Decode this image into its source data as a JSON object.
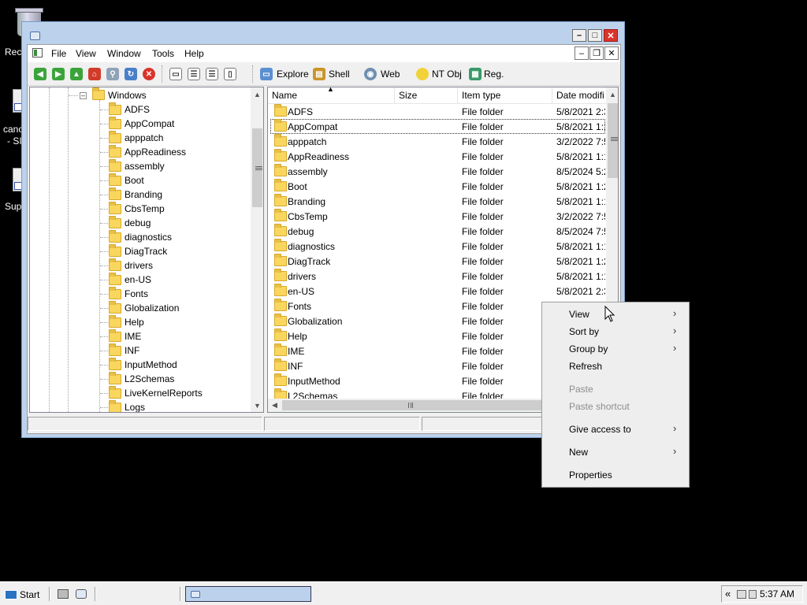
{
  "desktop": {
    "icons": [
      {
        "label": "Rec",
        "icon": "recycle-bin-icon"
      },
      {
        "label_line1": "canc",
        "label_line2": "- SI",
        "icon": "shortcut-icon"
      },
      {
        "label": "Sup",
        "icon": "shortcut-icon"
      }
    ]
  },
  "window": {
    "title": "",
    "menu": [
      "File",
      "View",
      "Window",
      "Tools",
      "Help"
    ],
    "toolbar": {
      "nav_icons": [
        "back-icon",
        "forward-icon",
        "up-icon",
        "home-icon",
        "search-icon",
        "refresh-icon",
        "stop-icon",
        "new-window-icon",
        "tile-horizontal-icon",
        "tile-vertical-icon",
        "cascade-icon"
      ],
      "buttons": [
        {
          "label": "Explore",
          "icon": "explore-icon"
        },
        {
          "label": "Shell",
          "icon": "shell-icon"
        },
        {
          "label": "Web",
          "icon": "web-icon"
        },
        {
          "label": "NT Obj",
          "icon": "nt-obj-icon"
        },
        {
          "label": "Reg.",
          "icon": "registry-icon"
        }
      ]
    },
    "tree": {
      "root": "Windows",
      "children": [
        "ADFS",
        "AppCompat",
        "apppatch",
        "AppReadiness",
        "assembly",
        "Boot",
        "Branding",
        "CbsTemp",
        "debug",
        "diagnostics",
        "DiagTrack",
        "drivers",
        "en-US",
        "Fonts",
        "Globalization",
        "Help",
        "IME",
        "INF",
        "InputMethod",
        "L2Schemas",
        "LiveKernelReports",
        "Logs"
      ]
    },
    "list": {
      "columns": [
        "Name",
        "Size",
        "Item type",
        "Date modifi"
      ],
      "sort_column": "Name",
      "focused_row": "AppCompat",
      "rows": [
        {
          "name": "ADFS",
          "size": "",
          "type": "File folder",
          "date": "5/8/2021 2:3"
        },
        {
          "name": "AppCompat",
          "size": "",
          "type": "File folder",
          "date": "5/8/2021 1:1"
        },
        {
          "name": "apppatch",
          "size": "",
          "type": "File folder",
          "date": "3/2/2022 7:5"
        },
        {
          "name": "AppReadiness",
          "size": "",
          "type": "File folder",
          "date": "5/8/2021 1:1"
        },
        {
          "name": "assembly",
          "size": "",
          "type": "File folder",
          "date": "8/5/2024 5:2"
        },
        {
          "name": "Boot",
          "size": "",
          "type": "File folder",
          "date": "5/8/2021 1:2"
        },
        {
          "name": "Branding",
          "size": "",
          "type": "File folder",
          "date": "5/8/2021 1:1"
        },
        {
          "name": "CbsTemp",
          "size": "",
          "type": "File folder",
          "date": "3/2/2022 7:5"
        },
        {
          "name": "debug",
          "size": "",
          "type": "File folder",
          "date": "8/5/2024 7:5"
        },
        {
          "name": "diagnostics",
          "size": "",
          "type": "File folder",
          "date": "5/8/2021 1:1"
        },
        {
          "name": "DiagTrack",
          "size": "",
          "type": "File folder",
          "date": "5/8/2021 1:2"
        },
        {
          "name": "drivers",
          "size": "",
          "type": "File folder",
          "date": "5/8/2021 1:1"
        },
        {
          "name": "en-US",
          "size": "",
          "type": "File folder",
          "date": "5/8/2021 2:3"
        },
        {
          "name": "Fonts",
          "size": "",
          "type": "File folder",
          "date": ""
        },
        {
          "name": "Globalization",
          "size": "",
          "type": "File folder",
          "date": ""
        },
        {
          "name": "Help",
          "size": "",
          "type": "File folder",
          "date": ""
        },
        {
          "name": "IME",
          "size": "",
          "type": "File folder",
          "date": ""
        },
        {
          "name": "INF",
          "size": "",
          "type": "File folder",
          "date": ""
        },
        {
          "name": "InputMethod",
          "size": "",
          "type": "File folder",
          "date": ""
        },
        {
          "name": "L2Schemas",
          "size": "",
          "type": "File folder",
          "date": ""
        }
      ]
    }
  },
  "context_menu": {
    "items": [
      {
        "label": "View",
        "submenu": true,
        "disabled": false
      },
      {
        "label": "Sort by",
        "submenu": true,
        "disabled": false
      },
      {
        "label": "Group by",
        "submenu": true,
        "disabled": false
      },
      {
        "label": "Refresh",
        "submenu": false,
        "disabled": false
      },
      {
        "label": "Paste",
        "submenu": false,
        "disabled": true
      },
      {
        "label": "Paste shortcut",
        "submenu": false,
        "disabled": true
      },
      {
        "label": "Give access to",
        "submenu": true,
        "disabled": false
      },
      {
        "label": "New",
        "submenu": true,
        "disabled": false
      },
      {
        "label": "Properties",
        "submenu": false,
        "disabled": false
      }
    ]
  },
  "taskbar": {
    "start_label": "Start",
    "tray_chevron": "«",
    "clock": "5:37 AM"
  },
  "colors": {
    "window_frame": "#bcd2ec",
    "close_red": "#d9342b",
    "folder_yellow": "#f9d65e"
  }
}
